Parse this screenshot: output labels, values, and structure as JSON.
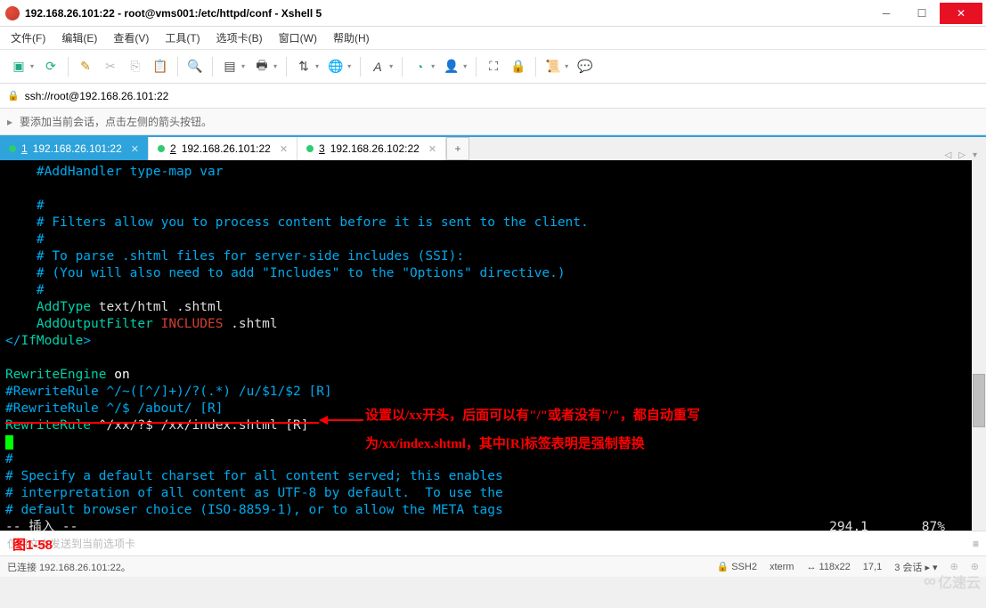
{
  "window": {
    "title": "192.168.26.101:22 - root@vms001:/etc/httpd/conf - Xshell 5"
  },
  "menu": {
    "file": "文件(F)",
    "edit": "编辑(E)",
    "view": "查看(V)",
    "tools": "工具(T)",
    "tabs": "选项卡(B)",
    "window": "窗口(W)",
    "help": "帮助(H)"
  },
  "address": {
    "url": "ssh://root@192.168.26.101:22"
  },
  "infobar": {
    "text": "要添加当前会话，点击左侧的箭头按钮。"
  },
  "tabs": [
    {
      "num": "1",
      "label": "192.168.26.101:22",
      "active": true
    },
    {
      "num": "2",
      "label": "192.168.26.101:22",
      "active": false
    },
    {
      "num": "3",
      "label": "192.168.26.102:22",
      "active": false
    }
  ],
  "terminal": {
    "lines": [
      {
        "indent": "    ",
        "cls": "c-com",
        "text": "#AddHandler type-map var"
      },
      {
        "raw": ""
      },
      {
        "indent": "    ",
        "cls": "c-com",
        "text": "#"
      },
      {
        "indent": "    ",
        "cls": "c-com",
        "text": "# Filters allow you to process content before it is sent to the client."
      },
      {
        "indent": "    ",
        "cls": "c-com",
        "text": "#"
      },
      {
        "indent": "    ",
        "cls": "c-com",
        "text": "# To parse .shtml files for server-side includes (SSI):"
      },
      {
        "indent": "    ",
        "cls": "c-com",
        "text": "# (You will also need to add \"Includes\" to the \"Options\" directive.)"
      },
      {
        "indent": "    ",
        "cls": "c-com",
        "text": "#"
      },
      {
        "indent": "    ",
        "parts": [
          {
            "cls": "c-dir",
            "t": "AddType"
          },
          {
            "cls": "",
            "t": " text/html .shtml"
          }
        ]
      },
      {
        "indent": "    ",
        "parts": [
          {
            "cls": "c-dir",
            "t": "AddOutputFilter"
          },
          {
            "cls": "",
            "t": " "
          },
          {
            "cls": "c-inc",
            "t": "INCLUDES"
          },
          {
            "cls": "",
            "t": " .shtml"
          }
        ]
      },
      {
        "parts": [
          {
            "cls": "c-com",
            "t": "</"
          },
          {
            "cls": "c-dir",
            "t": "IfModule"
          },
          {
            "cls": "c-com",
            "t": ">"
          }
        ]
      },
      {
        "raw": ""
      },
      {
        "parts": [
          {
            "cls": "c-dir",
            "t": "RewriteEngine"
          },
          {
            "cls": "",
            "t": " "
          },
          {
            "cls": "c-white",
            "t": "on"
          }
        ]
      },
      {
        "cls": "c-com",
        "text": "#RewriteRule ^/~([^/]+)/?(.*) /u/$1/$2 [R]"
      },
      {
        "cls": "c-com",
        "text": "#RewriteRule ^/$ /about/ [R]"
      },
      {
        "parts": [
          {
            "cls": "c-dir",
            "t": "RewriteRule"
          },
          {
            "cls": "",
            "t": " ^/xx/?$ /xx/index.shtml [R]"
          }
        ]
      },
      {
        "parts": [
          {
            "cls": "cursor",
            "t": " "
          }
        ]
      },
      {
        "cls": "c-com",
        "text": "#"
      },
      {
        "cls": "c-com",
        "text": "# Specify a default charset for all content served; this enables"
      },
      {
        "cls": "c-com",
        "text": "# interpretation of all content as UTF-8 by default.  To use the"
      },
      {
        "cls": "c-com",
        "text": "# default browser choice (ISO-8859-1), or to allow the META tags"
      }
    ],
    "modeline": {
      "left": "-- 插入 --",
      "pos": "294,1",
      "pct": "87%"
    }
  },
  "annotations": {
    "line1": "设置以/xx开头，后面可以有\"/\"或者没有\"/\"，都自动重写",
    "line2": "为/xx/index.shtml，其中[R]标签表明是强制替换",
    "fig": "图1-58"
  },
  "footer": {
    "placeholder": "仅将文本发送到当前选项卡"
  },
  "status": {
    "connected": "已连接 192.168.26.101:22。",
    "ssh": "SSH2",
    "term": "xterm",
    "size": "118x22",
    "cursor": "17,1",
    "sessions": "3 会话"
  },
  "watermark": "亿速云"
}
